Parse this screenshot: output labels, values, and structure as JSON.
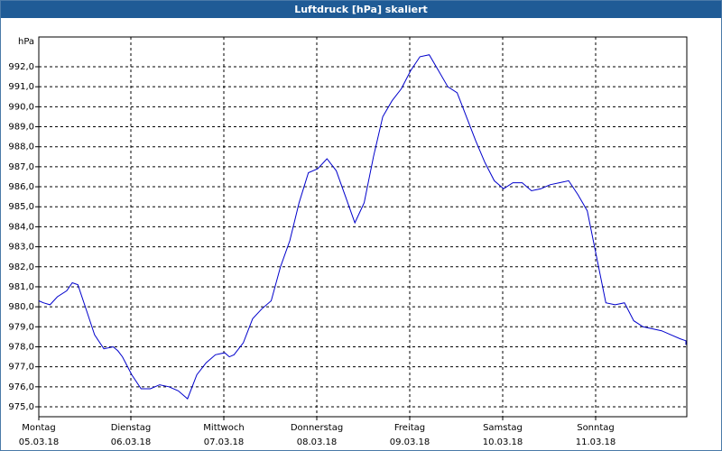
{
  "window": {
    "title": "Luftdruck [hPa] skaliert"
  },
  "chart_data": {
    "type": "line",
    "title": "Luftdruck [hPa] skaliert",
    "ylabel": "hPa",
    "ylim": [
      975.0,
      992.0
    ],
    "y_ticks": [
      "975,0",
      "976,0",
      "977,0",
      "978,0",
      "979,0",
      "980,0",
      "981,0",
      "982,0",
      "983,0",
      "984,0",
      "985,0",
      "986,0",
      "987,0",
      "988,0",
      "989,0",
      "990,0",
      "991,0",
      "992,0"
    ],
    "x_ticks": [
      {
        "day": "Montag",
        "date": "05.03.18"
      },
      {
        "day": "Dienstag",
        "date": "06.03.18"
      },
      {
        "day": "Mittwoch",
        "date": "07.03.18"
      },
      {
        "day": "Donnerstag",
        "date": "08.03.18"
      },
      {
        "day": "Freitag",
        "date": "09.03.18"
      },
      {
        "day": "Samstag",
        "date": "10.03.18"
      },
      {
        "day": "Sonntag",
        "date": "11.03.18"
      }
    ],
    "grid": true,
    "line_color": "#0000cc",
    "series": [
      {
        "x": [
          0.0,
          0.05,
          0.12,
          0.2,
          0.3,
          0.36,
          0.42,
          0.5,
          0.6,
          0.7,
          0.8,
          0.85,
          0.9,
          1.0,
          1.1,
          1.2,
          1.3,
          1.4,
          1.5,
          1.6,
          1.7,
          1.8,
          1.9,
          2.0,
          2.05,
          2.1,
          2.2,
          2.3,
          2.4,
          2.5,
          2.6,
          2.7,
          2.8,
          2.9,
          3.0,
          3.1,
          3.2,
          3.3,
          3.4,
          3.5,
          3.6,
          3.7,
          3.8,
          3.9,
          4.0,
          4.1,
          4.2,
          4.3,
          4.4,
          4.5,
          4.6,
          4.7,
          4.8,
          4.9,
          5.0,
          5.1,
          5.2,
          5.3,
          5.4,
          5.5,
          5.6,
          5.7,
          5.8,
          5.9,
          6.0,
          6.1,
          6.2,
          6.3,
          6.4,
          6.5,
          6.6,
          6.7,
          6.8,
          6.9,
          7.0,
          7.15
        ],
        "y": [
          980.3,
          980.2,
          980.1,
          980.5,
          980.8,
          981.2,
          981.1,
          980.0,
          978.6,
          977.9,
          978.0,
          977.8,
          977.5,
          976.6,
          975.9,
          975.9,
          976.1,
          976.0,
          975.8,
          975.4,
          976.6,
          977.2,
          977.6,
          977.7,
          977.5,
          977.6,
          978.2,
          979.4,
          979.9,
          980.3,
          982.0,
          983.3,
          985.2,
          986.7,
          986.9,
          987.4,
          986.8,
          985.5,
          984.2,
          985.2,
          987.5,
          989.5,
          990.3,
          990.9,
          991.8,
          992.5,
          992.6,
          991.8,
          991.0,
          990.7,
          989.5,
          988.3,
          987.2,
          986.3,
          985.9,
          986.2,
          986.2,
          985.8,
          985.9,
          986.1,
          986.2,
          986.3,
          985.6,
          984.8,
          982.5,
          980.2,
          980.1,
          980.2,
          979.3,
          979.0,
          978.9,
          978.8,
          978.6,
          978.4,
          978.3,
          978.1
        ]
      }
    ]
  }
}
